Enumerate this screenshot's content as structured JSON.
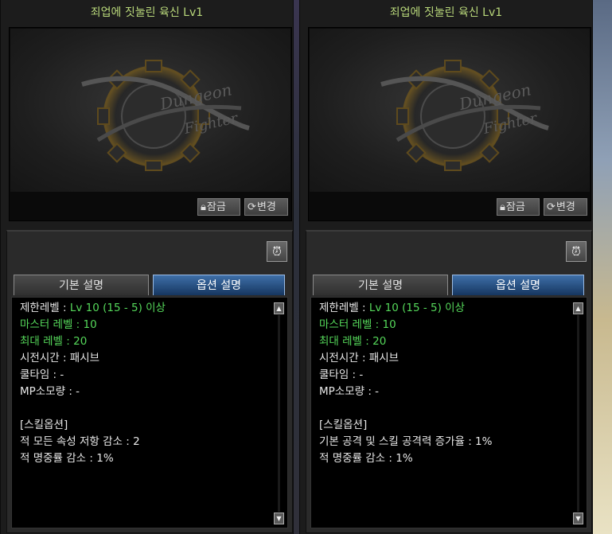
{
  "panels": [
    {
      "title": "죄업에 짓눌린 육신 Lv1",
      "preview": {
        "lock_label": "잠금",
        "change_label": "변경"
      },
      "tabs": {
        "basic": "기본 설명",
        "option": "옵션 설명",
        "active": "option"
      },
      "lines": [
        {
          "label": "제한레벨 : ",
          "value": "Lv 10 (15 - 5) 이상"
        },
        {
          "text": "마스터 레벨 : 10"
        },
        {
          "text": "최대 레벨 : 20"
        },
        {
          "text": "시전시간 : 패시브"
        },
        {
          "text": "쿨타임 : -"
        },
        {
          "text": "MP소모량 : -"
        },
        {
          "text": ""
        },
        {
          "text": "[스킬옵션]"
        },
        {
          "text": "적 모든 속성 저항 감소 : 2"
        },
        {
          "text": "적 명중률 감소 : 1%"
        }
      ]
    },
    {
      "title": "죄업에 짓눌린 육신 Lv1",
      "preview": {
        "lock_label": "잠금",
        "change_label": "변경"
      },
      "tabs": {
        "basic": "기본 설명",
        "option": "옵션 설명",
        "active": "option"
      },
      "lines": [
        {
          "label": "제한레벨 : ",
          "value": "Lv 10 (15 - 5) 이상"
        },
        {
          "text": "마스터 레벨 : 10"
        },
        {
          "text": "최대 레벨 : 20"
        },
        {
          "text": "시전시간 : 패시브"
        },
        {
          "text": "쿨타임 : -"
        },
        {
          "text": "MP소모량 : -"
        },
        {
          "text": ""
        },
        {
          "text": "[스킬옵션]"
        },
        {
          "text": "기본 공격 및 스킬 공격력 증가율 : 1%"
        },
        {
          "text": "적 명중률 감소 : 1%"
        }
      ]
    }
  ],
  "colors": {
    "title": "#b8d77a",
    "highlight_green": "#55d85a",
    "tab_active": "#1f4c86",
    "body_text": "#e8e8e8"
  },
  "icons": {
    "lock": "lock-icon",
    "change": "refresh-icon",
    "alarm": "alarm-clock-icon",
    "scroll_up": "scroll-up-arrow-icon",
    "scroll_down": "scroll-down-arrow-icon"
  }
}
